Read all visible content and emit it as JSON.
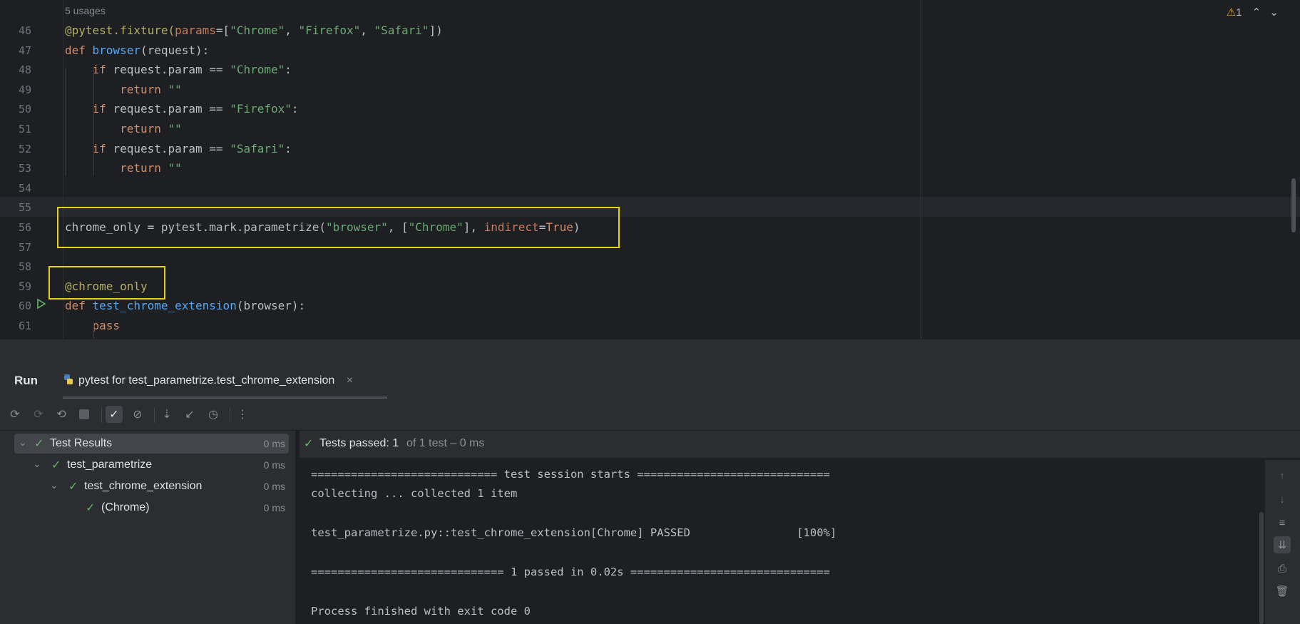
{
  "editor": {
    "usages": "5 usages",
    "warning_count": "1",
    "lines": [
      {
        "n": "46",
        "parts": [
          [
            "@pytest.fixture(",
            "dec"
          ],
          [
            "params",
            "param"
          ],
          [
            "=[",
            ""
          ],
          [
            "\"Chrome\"",
            "str"
          ],
          [
            ", ",
            ""
          ],
          [
            "\"Firefox\"",
            "str"
          ],
          [
            ", ",
            ""
          ],
          [
            "\"Safari\"",
            "str"
          ],
          [
            "])",
            ""
          ]
        ]
      },
      {
        "n": "47",
        "parts": [
          [
            "def ",
            "kw"
          ],
          [
            "browser",
            "fn"
          ],
          [
            "(request):",
            ""
          ]
        ]
      },
      {
        "n": "48",
        "parts": [
          [
            "    ",
            ""
          ],
          [
            "if ",
            "kw"
          ],
          [
            "request.param == ",
            ""
          ],
          [
            "\"Chrome\"",
            "str"
          ],
          [
            ":",
            ""
          ]
        ]
      },
      {
        "n": "49",
        "parts": [
          [
            "        ",
            ""
          ],
          [
            "return ",
            "kw"
          ],
          [
            "\"\"",
            "str"
          ]
        ]
      },
      {
        "n": "50",
        "parts": [
          [
            "    ",
            ""
          ],
          [
            "if ",
            "kw"
          ],
          [
            "request.param == ",
            ""
          ],
          [
            "\"Firefox\"",
            "str"
          ],
          [
            ":",
            ""
          ]
        ]
      },
      {
        "n": "51",
        "parts": [
          [
            "        ",
            ""
          ],
          [
            "return ",
            "kw"
          ],
          [
            "\"\"",
            "str"
          ]
        ]
      },
      {
        "n": "52",
        "parts": [
          [
            "    ",
            ""
          ],
          [
            "if ",
            "kw"
          ],
          [
            "request.param == ",
            ""
          ],
          [
            "\"Safari\"",
            "str"
          ],
          [
            ":",
            ""
          ]
        ]
      },
      {
        "n": "53",
        "parts": [
          [
            "        ",
            ""
          ],
          [
            "return ",
            "kw"
          ],
          [
            "\"\"",
            "str"
          ]
        ]
      },
      {
        "n": "54",
        "parts": []
      },
      {
        "n": "55",
        "parts": []
      },
      {
        "n": "56",
        "parts": [
          [
            "chrome_only = pytest.mark.parametrize(",
            ""
          ],
          [
            "\"browser\"",
            "str"
          ],
          [
            ", [",
            ""
          ],
          [
            "\"Chrome\"",
            "str"
          ],
          [
            "], ",
            ""
          ],
          [
            "indirect",
            "param"
          ],
          [
            "=",
            ""
          ],
          [
            "True",
            "kw"
          ],
          [
            ")",
            ""
          ]
        ]
      },
      {
        "n": "57",
        "parts": []
      },
      {
        "n": "58",
        "parts": []
      },
      {
        "n": "59",
        "parts": [
          [
            "@chrome_only",
            "dec"
          ]
        ]
      },
      {
        "n": "60",
        "parts": [
          [
            "def ",
            "kw"
          ],
          [
            "test_chrome_extension",
            "fn"
          ],
          [
            "(browser):",
            ""
          ]
        ]
      },
      {
        "n": "61",
        "parts": [
          [
            "    ",
            ""
          ],
          [
            "pass",
            "kw"
          ]
        ]
      }
    ]
  },
  "run_panel": {
    "title": "Run",
    "tab_label": "pytest for test_parametrize.test_chrome_extension",
    "close": "×",
    "status_passed": "Tests passed: 1",
    "status_detail": " of 1 test – 0 ms",
    "tree": [
      {
        "label": "Test Results",
        "ms": "0 ms"
      },
      {
        "label": "test_parametrize",
        "ms": "0 ms"
      },
      {
        "label": "test_chrome_extension",
        "ms": "0 ms"
      },
      {
        "label": "(Chrome)",
        "ms": "0 ms"
      }
    ],
    "console": [
      "============================ test session starts =============================",
      "collecting ... collected 1 item",
      "",
      "test_parametrize.py::test_chrome_extension[Chrome] PASSED                [100%]",
      "",
      "============================= 1 passed in 0.02s ==============================",
      "",
      "Process finished with exit code 0"
    ]
  },
  "colors": {
    "highlight_box": "#e6d31a",
    "pass_green": "#5fb865"
  }
}
